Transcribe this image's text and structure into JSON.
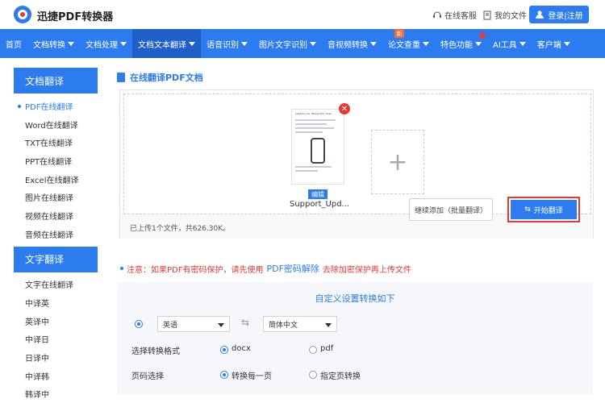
{
  "header": {
    "brand": "迅捷PDF转换器",
    "service": "在线客服",
    "my_files": "我的文件",
    "login": "登录|注册"
  },
  "nav": [
    {
      "label": "首页",
      "caret": false
    },
    {
      "label": "文档转换",
      "caret": true
    },
    {
      "label": "文档处理",
      "caret": true
    },
    {
      "label": "文档文本翻译",
      "caret": true
    },
    {
      "label": "语音识别",
      "caret": true
    },
    {
      "label": "图片文字识别",
      "caret": true
    },
    {
      "label": "音视频转换",
      "caret": true
    },
    {
      "label": "论文查重",
      "caret": true
    },
    {
      "label": "特色功能",
      "caret": true
    },
    {
      "label": "AI工具",
      "caret": true
    },
    {
      "label": "客户端",
      "caret": true
    }
  ],
  "nav_badge": "新",
  "sidebar": {
    "doc_header": "文档翻译",
    "doc_items": [
      "PDF在线翻译",
      "Word在线翻译",
      "TXT在线翻译",
      "PPT在线翻译",
      "Excel在线翻译",
      "图片在线翻译",
      "视频在线翻译",
      "音频在线翻译"
    ],
    "text_header": "文字翻译",
    "text_items": [
      "文字在线翻译",
      "中译英",
      "英译中",
      "中译日",
      "日译中",
      "中译韩",
      "韩译中"
    ]
  },
  "main": {
    "title": "在线翻译PDF文档",
    "file_name": "Support_Upd...",
    "edit_tag": "编辑",
    "doc_preview_title": "Leaders you \"Phone Pro\" how",
    "upload_status": "已上传1个文件，共626.30K。",
    "continue_btn": "继续添加（批量翻译）",
    "start_btn": "开始翻译",
    "notice_prefix": "注意：如果PDF有密码保护，请先使用",
    "notice_link": "PDF密码解除",
    "notice_suffix": "去除加密保护再上传文件"
  },
  "settings": {
    "title": "自定义设置转换如下",
    "source_lang": "英语",
    "target_lang": "简体中文",
    "format_label": "选择转换格式",
    "format_options": [
      "docx",
      "pdf"
    ],
    "page_label": "页码选择",
    "page_options": [
      "转换每一页",
      "指定页转换"
    ]
  },
  "colors": {
    "accent": "#2c7cf0",
    "warning": "#e53935"
  }
}
